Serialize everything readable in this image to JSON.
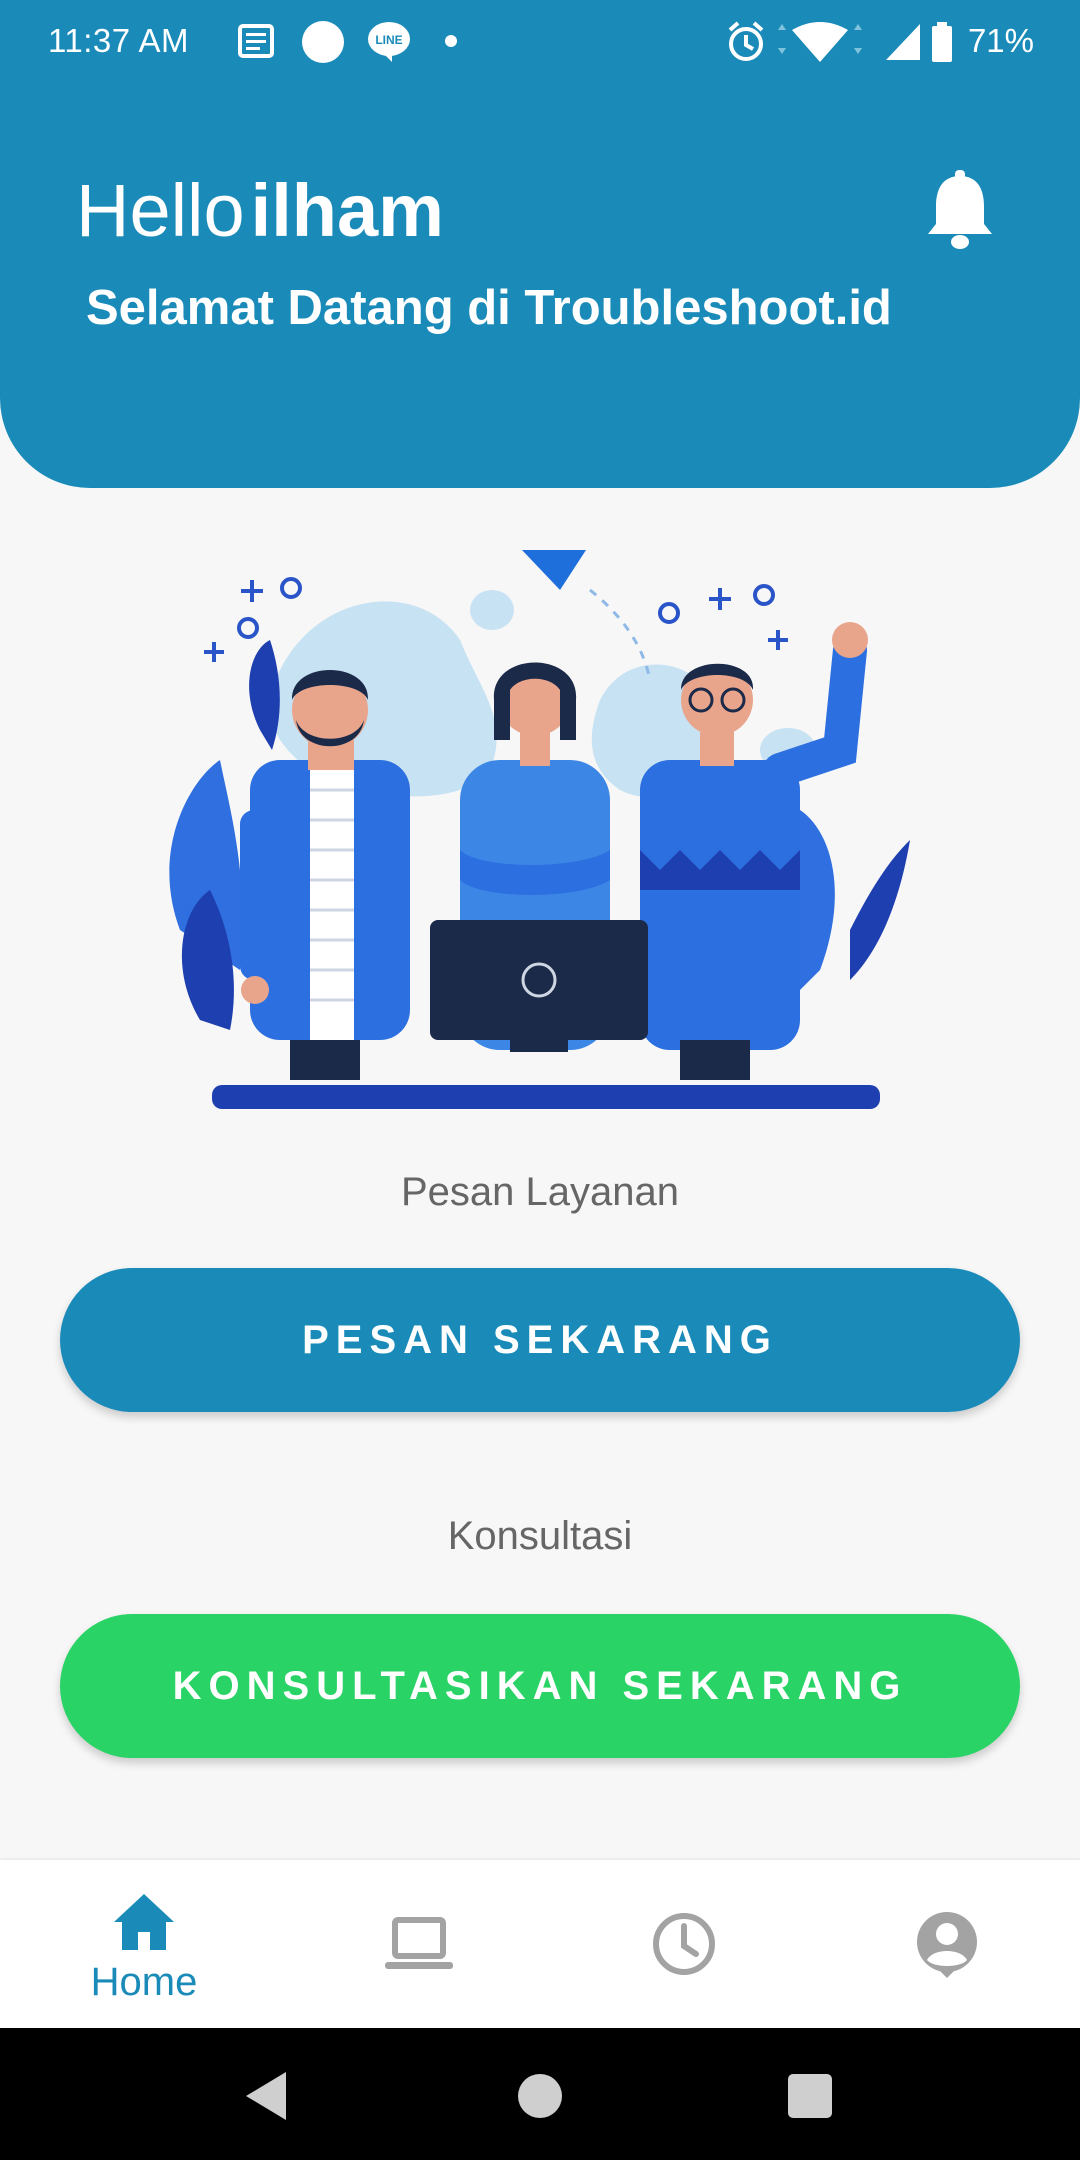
{
  "status_bar": {
    "time": "11:37 AM",
    "battery": "71%"
  },
  "header": {
    "greeting": "Hello",
    "user_name": "ilham",
    "welcome": "Selamat Datang di Troubleshoot.id"
  },
  "order_section": {
    "label": "Pesan Layanan",
    "button": "PESAN SEKARANG"
  },
  "consult_section": {
    "label": "Konsultasi",
    "button": "KONSULTASIKAN SEKARANG"
  },
  "bottom_nav": {
    "items": [
      {
        "icon": "home-icon",
        "label": "Home",
        "active": true
      },
      {
        "icon": "laptop-icon",
        "label": "",
        "active": false
      },
      {
        "icon": "clock-icon",
        "label": "",
        "active": false
      },
      {
        "icon": "account-icon",
        "label": "",
        "active": false
      }
    ]
  },
  "colors": {
    "primary": "#1a8bb9",
    "green": "#2ad366",
    "inactive": "#a3a3a3"
  }
}
